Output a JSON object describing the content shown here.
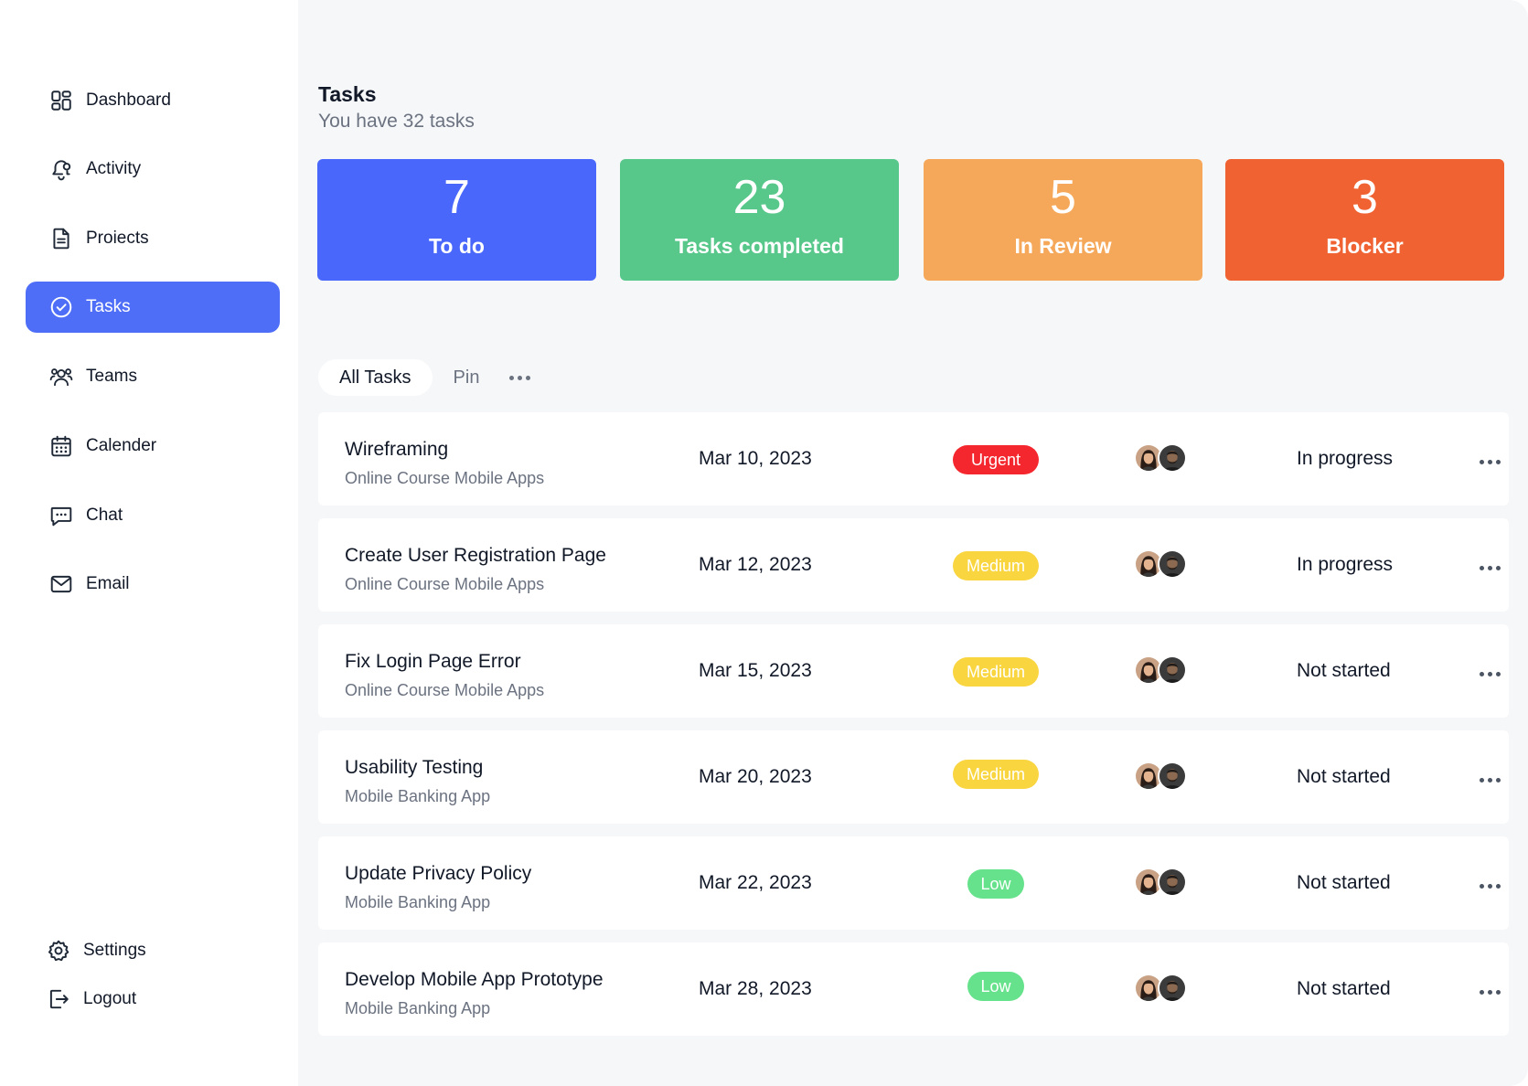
{
  "sidebar": {
    "items": [
      {
        "label": "Dashboard",
        "icon": "dashboard-icon",
        "active": false
      },
      {
        "label": "Activity",
        "icon": "bell-icon",
        "active": false
      },
      {
        "label": "Proiects",
        "icon": "document-icon",
        "active": false
      },
      {
        "label": "Tasks",
        "icon": "check-circle-icon",
        "active": true
      },
      {
        "label": "Teams",
        "icon": "users-icon",
        "active": false
      },
      {
        "label": "Calender",
        "icon": "calendar-icon",
        "active": false
      },
      {
        "label": "Chat",
        "icon": "chat-icon",
        "active": false
      },
      {
        "label": "Email",
        "icon": "mail-icon",
        "active": false
      }
    ],
    "footer": [
      {
        "label": "Settings",
        "icon": "gear-icon"
      },
      {
        "label": "Logout",
        "icon": "logout-icon"
      }
    ]
  },
  "header": {
    "title": "Tasks",
    "subtitle": "You have 32 tasks"
  },
  "stats": [
    {
      "value": "7",
      "label": "To do",
      "color": "#4968fb"
    },
    {
      "value": "23",
      "label": "Tasks completed",
      "color": "#57c78a"
    },
    {
      "value": "5",
      "label": "In Review",
      "color": "#f6a85a"
    },
    {
      "value": "3",
      "label": "Blocker",
      "color": "#f06232"
    }
  ],
  "tabs": {
    "all": "All Tasks",
    "pin": "Pin"
  },
  "priority_colors": {
    "Urgent": "#f5272e",
    "Medium": "#f9d540",
    "Low": "#67e28c"
  },
  "tasks": [
    {
      "name": "Wireframing",
      "project": "Online Course Mobile Apps",
      "date": "Mar 10, 2023",
      "priority": "Urgent",
      "status": "In progress"
    },
    {
      "name": "Create User Registration Page",
      "project": "Online Course Mobile Apps",
      "date": "Mar 12, 2023",
      "priority": "Medium",
      "status": "In progress"
    },
    {
      "name": "Fix Login Page Error",
      "project": "Online Course Mobile Apps",
      "date": "Mar 15, 2023",
      "priority": "Medium",
      "status": "Not started"
    },
    {
      "name": "Usability Testing",
      "project": "Mobile Banking  App",
      "date": "Mar 20, 2023",
      "priority": "Medium",
      "status": "Not started"
    },
    {
      "name": "Update Privacy Policy",
      "project": "Mobile Banking  App",
      "date": "Mar 22, 2023",
      "priority": "Low",
      "status": "Not started"
    },
    {
      "name": "Develop Mobile App Prototype",
      "project": "Mobile Banking  App",
      "date": "Mar 28, 2023",
      "priority": "Low",
      "status": "Not started"
    }
  ]
}
